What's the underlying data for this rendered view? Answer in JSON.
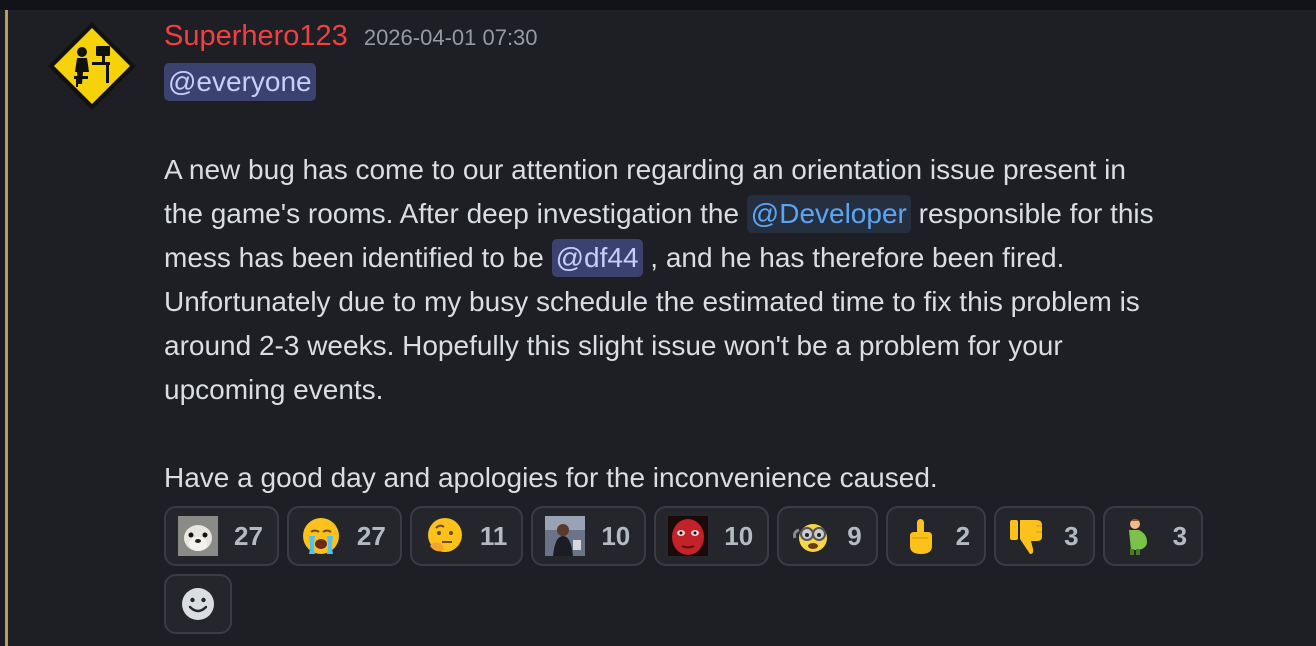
{
  "message": {
    "author": "Superhero123",
    "timestamp": "2026-04-01 07:30",
    "mention_everyone": "@everyone",
    "line1": "A new bug has come to our attention regarding an orientation issue present in",
    "line2_a": "the game's rooms. After deep investigation the ",
    "role_mention": "@Developer",
    "line2_b": " responsible for this",
    "line3_a": "mess has been identified to be ",
    "user_mention": "@df44",
    "line3_b": " , and he has therefore been fired.",
    "line4": "Unfortunately due to my busy schedule the estimated time to fix this problem is",
    "line5": "around 2-3 weeks. Hopefully this slight issue won't be a problem for your",
    "line6": "upcoming events.",
    "closing": "Have a good day and apologies for the inconvenience caused."
  },
  "reactions": [
    {
      "emoji": "seal-icon",
      "count": "27"
    },
    {
      "emoji": "crying-face-icon",
      "count": "27"
    },
    {
      "emoji": "thinking-face-icon",
      "count": "11"
    },
    {
      "emoji": "man-photo-icon",
      "count": "10"
    },
    {
      "emoji": "red-face-icon",
      "count": "10"
    },
    {
      "emoji": "tired-minion-icon",
      "count": "9"
    },
    {
      "emoji": "middle-finger-icon",
      "count": "2"
    },
    {
      "emoji": "thumbs-down-icon",
      "count": "3"
    },
    {
      "emoji": "pregnant-man-icon",
      "count": "3"
    }
  ],
  "colors": {
    "author": "#f23f42",
    "mention_bg": "#3c4270",
    "role_mention": "#5aa6f5",
    "border_accent": "#c49a5c"
  }
}
